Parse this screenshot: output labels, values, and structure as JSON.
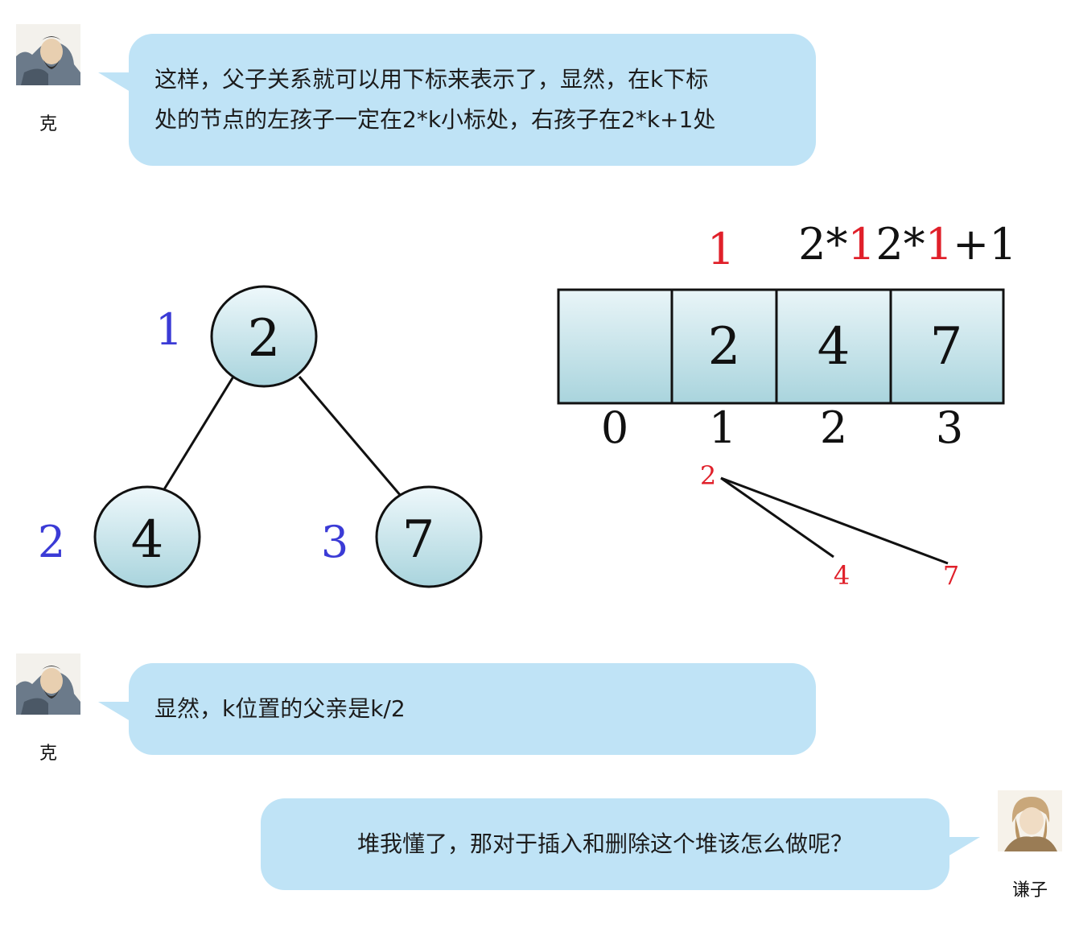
{
  "messages": [
    {
      "side": "left",
      "speaker": "克",
      "lines": [
        "这样，父子关系就可以用下标来表示了，显然，在k下标",
        "处的节点的左孩子一定在2*k小标处，右孩子在2*k+1处"
      ]
    },
    {
      "side": "left",
      "speaker": "克",
      "lines": [
        "显然，k位置的父亲是k/2"
      ]
    },
    {
      "side": "right",
      "speaker": "谦子",
      "lines": [
        "堆我懂了，那对于插入和删除这个堆该怎么做呢？"
      ]
    }
  ],
  "diagram": {
    "tree": {
      "nodes": [
        {
          "value": "2",
          "index": "1"
        },
        {
          "value": "4",
          "index": "2"
        },
        {
          "value": "7",
          "index": "3"
        }
      ]
    },
    "array": {
      "cells": [
        "",
        "2",
        "4",
        "7"
      ],
      "indices": [
        "0",
        "1",
        "2",
        "3"
      ],
      "top_labels": {
        "parent": "1",
        "left_prefix": "2*",
        "left_k": "1",
        "right_prefix": "2*",
        "right_k": "1",
        "right_suffix": "+1"
      }
    },
    "mini_tree": {
      "root": "2",
      "left": "4",
      "right": "7"
    },
    "colors": {
      "bubble": "#bfe3f6",
      "node_fill_top": "#eef8fb",
      "node_fill_bottom": "#a9d4dd",
      "index_blue": "#3b3bd6",
      "highlight_red": "#e0202a",
      "stroke": "#111111"
    }
  }
}
